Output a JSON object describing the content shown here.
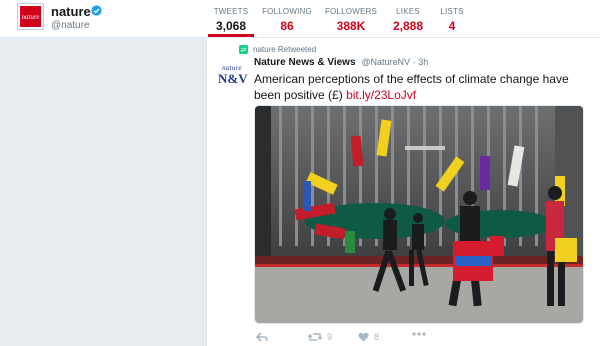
{
  "profile": {
    "name": "nature",
    "handle": "@nature",
    "avatar_text": "nature"
  },
  "stats": [
    {
      "label": "TWEETS",
      "value": "3,068"
    },
    {
      "label": "FOLLOWING",
      "value": "86"
    },
    {
      "label": "FOLLOWERS",
      "value": "388K"
    },
    {
      "label": "LIKES",
      "value": "2,888"
    },
    {
      "label": "LISTS",
      "value": "4"
    }
  ],
  "tweet": {
    "retweet_label": "nature Retweeted",
    "avatar_text_top": "nature",
    "avatar_text_bottom": "N&V",
    "author_name": "Nature News & Views",
    "author_handle": "@NatureNV",
    "time": "· 3h",
    "text": "American perceptions of the effects of climate change have been positive (£) ",
    "link": "bit.ly/23LoJvf",
    "retweets": "9",
    "likes": "8"
  },
  "colors": {
    "accent": "#d0021b",
    "verified": "#1da1f2",
    "retweet_green": "#19cf86"
  },
  "icons": [
    "verified-badge-icon",
    "retweet-icon",
    "reply-icon",
    "heart-icon",
    "more-icon"
  ]
}
